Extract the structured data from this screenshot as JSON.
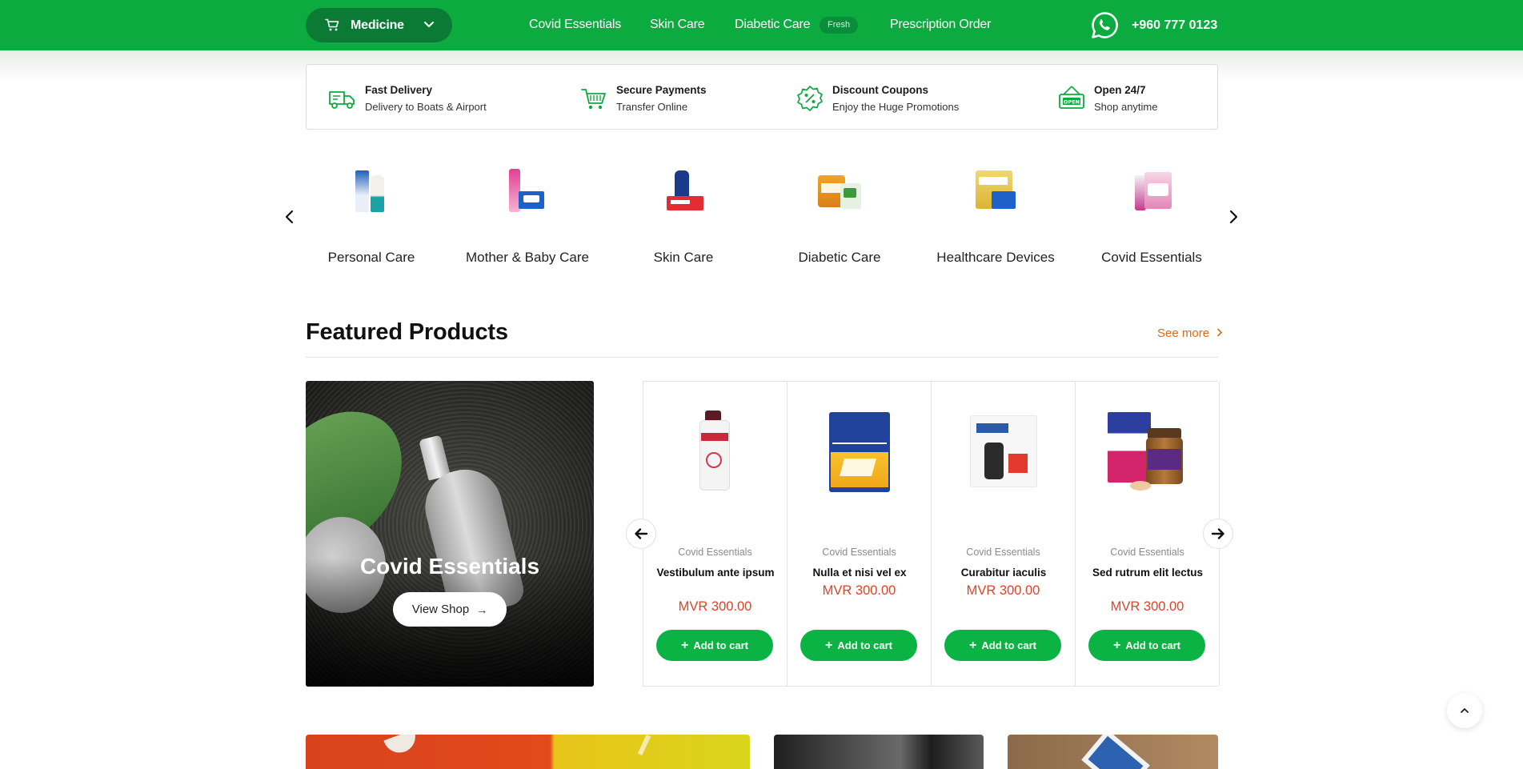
{
  "colors": {
    "brand_green": "#0bab3f",
    "dark_green": "#0a7a35",
    "price_red": "#d9442b",
    "see_more_orange": "#d66a1a"
  },
  "header": {
    "category_button": {
      "label": "Medicine",
      "icon": "cart-icon"
    },
    "nav": [
      {
        "label": "Covid Essentials"
      },
      {
        "label": "Skin Care"
      },
      {
        "label": "Diabetic Care",
        "badge": "Fresh"
      },
      {
        "label": "Prescription Order"
      }
    ],
    "phone": {
      "icon": "whatsapp-icon",
      "number": "+960 777 0123"
    }
  },
  "features": [
    {
      "icon": "delivery-truck-icon",
      "title": "Fast Delivery",
      "subtitle": "Delivery to Boats & Airport"
    },
    {
      "icon": "shopping-cart-icon",
      "title": "Secure Payments",
      "subtitle": "Transfer Online"
    },
    {
      "icon": "discount-badge-icon",
      "title": "Discount Coupons",
      "subtitle": "Enjoy the Huge Promotions"
    },
    {
      "icon": "open-sign-icon",
      "title": "Open 24/7",
      "subtitle": "Shop anytime"
    }
  ],
  "categories": [
    {
      "name": "Personal Care"
    },
    {
      "name": "Mother & Baby Care"
    },
    {
      "name": "Skin Care"
    },
    {
      "name": "Diabetic Care"
    },
    {
      "name": "Healthcare Devices"
    },
    {
      "name": "Covid Essentials"
    }
  ],
  "featured": {
    "title": "Featured Products",
    "see_more": "See more",
    "banner": {
      "title": "Covid Essentials",
      "button": "View Shop"
    },
    "products": [
      {
        "category": "Covid Essentials",
        "name": "Vestibulum ante ipsum",
        "price": "MVR 300.00",
        "button": "Add to cart"
      },
      {
        "category": "Covid Essentials",
        "name": "Nulla et nisi vel ex",
        "price": "MVR 300.00",
        "button": "Add to cart"
      },
      {
        "category": "Covid Essentials",
        "name": "Curabitur iaculis",
        "price": "MVR 300.00",
        "button": "Add to cart"
      },
      {
        "category": "Covid Essentials",
        "name": "Sed rutrum elit lectus",
        "price": "MVR 300.00",
        "button": "Add to cart"
      }
    ]
  }
}
